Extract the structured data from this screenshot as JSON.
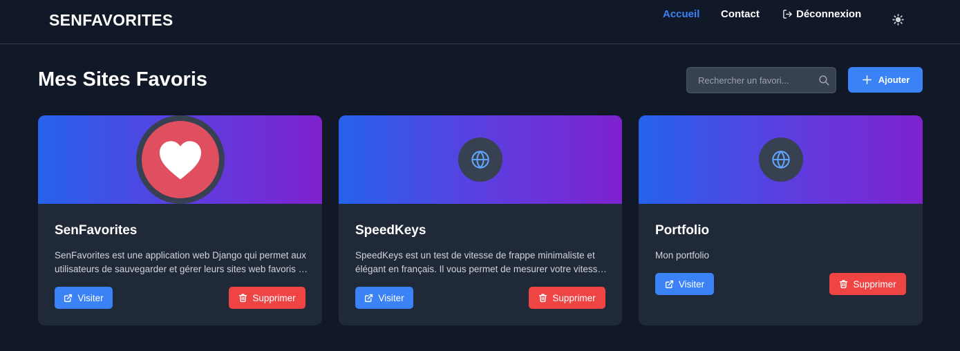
{
  "navbar": {
    "brand": "SENFAVORITES",
    "links": [
      {
        "label": "Accueil",
        "active": true
      },
      {
        "label": "Contact",
        "active": false
      },
      {
        "label": "Déconnexion",
        "active": false,
        "icon": "logout-icon"
      }
    ],
    "theme_toggle_icon": "sun-icon"
  },
  "header": {
    "title": "Mes Sites Favoris",
    "search_placeholder": "Rechercher un favori...",
    "search_value": "",
    "add_label": "Ajouter"
  },
  "cards": [
    {
      "title": "SenFavorites",
      "description": "SenFavorites est une application web Django qui permet aux utilisateurs de sauvegarder et gérer leurs sites web favoris de manière simple et efficace.",
      "icon": "heart-icon",
      "visit_label": "Visiter",
      "delete_label": "Supprimer"
    },
    {
      "title": "SpeedKeys",
      "description": "SpeedKeys est un test de vitesse de frappe minimaliste et élégant en français. Il vous permet de mesurer votre vitesse de frappe et votre précision.",
      "icon": "globe-icon",
      "visit_label": "Visiter",
      "delete_label": "Supprimer"
    },
    {
      "title": "Portfolio",
      "description": "Mon portfolio",
      "icon": "globe-icon",
      "visit_label": "Visiter",
      "delete_label": "Supprimer"
    }
  ],
  "colors": {
    "background": "#111827",
    "card": "#1f2937",
    "accent": "#3b82f6",
    "danger": "#ef4444",
    "heart": "#e04f5f"
  }
}
